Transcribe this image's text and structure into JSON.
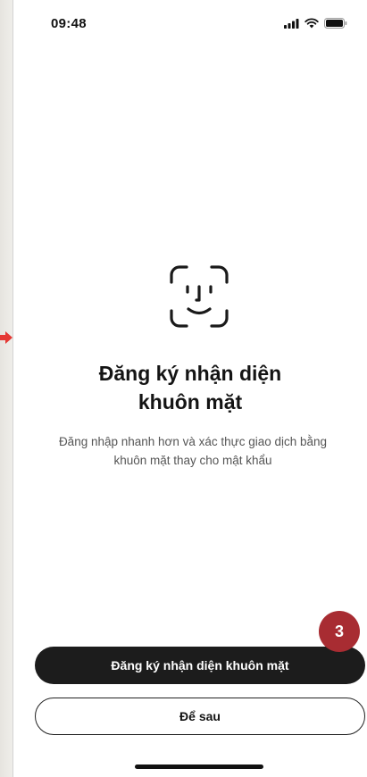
{
  "status_bar": {
    "time": "09:48",
    "icons": [
      "signal-icon",
      "wifi-icon",
      "battery-icon"
    ]
  },
  "face_icon": "face-id-icon",
  "content": {
    "title_line1": "Đăng ký nhận diện",
    "title_line2": "khuôn mặt",
    "subtitle": "Đăng nhập nhanh hơn và xác thực giao dịch bằng khuôn mặt thay cho mật khẩu"
  },
  "step_badge": "3",
  "actions": {
    "primary_label": "Đăng ký nhận diện khuôn mặt",
    "secondary_label": "Để sau"
  },
  "colors": {
    "badge": "#a82c32",
    "primary_button": "#1c1c1c",
    "arrow": "#e53935"
  }
}
